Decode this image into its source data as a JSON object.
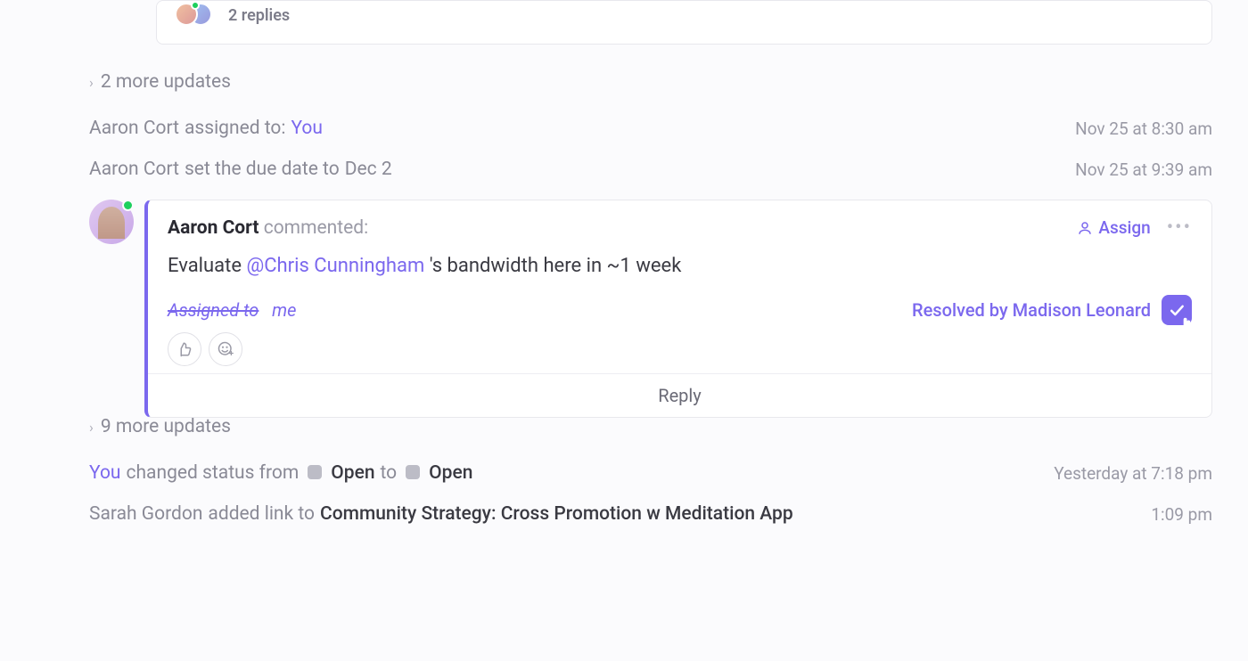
{
  "thread": {
    "replies_label": "2 replies"
  },
  "updates_top": {
    "label": "2 more updates"
  },
  "activity": [
    {
      "actor": "Aaron Cort",
      "verb": "assigned to:",
      "target": "You",
      "timestamp": "Nov 25 at 8:30 am"
    },
    {
      "actor": "Aaron Cort",
      "verb": "set the due date to",
      "target_plain": "Dec 2",
      "timestamp": "Nov 25 at 9:39 am"
    }
  ],
  "comment": {
    "author": "Aaron Cort",
    "verb": "commented:",
    "body_prefix": "Evaluate ",
    "mention": "@Chris Cunningham",
    "body_suffix": " 's bandwidth here in ~1 week",
    "assign_btn": "Assign",
    "assigned_to_label": "Assigned to",
    "assigned_to_target": "me",
    "resolved_by": "Resolved by Madison Leonard",
    "reply_label": "Reply"
  },
  "updates_mid": {
    "label": "9 more updates"
  },
  "activity2": {
    "actor": "You",
    "verb": "changed status from",
    "status_from": "Open",
    "to_word": "to",
    "status_to": "Open",
    "timestamp": "Yesterday at 7:18 pm"
  },
  "activity3": {
    "actor": "Sarah Gordon",
    "verb": "added link to",
    "link_title": "Community Strategy: Cross Promotion w Meditation App",
    "timestamp": "1:09 pm"
  }
}
